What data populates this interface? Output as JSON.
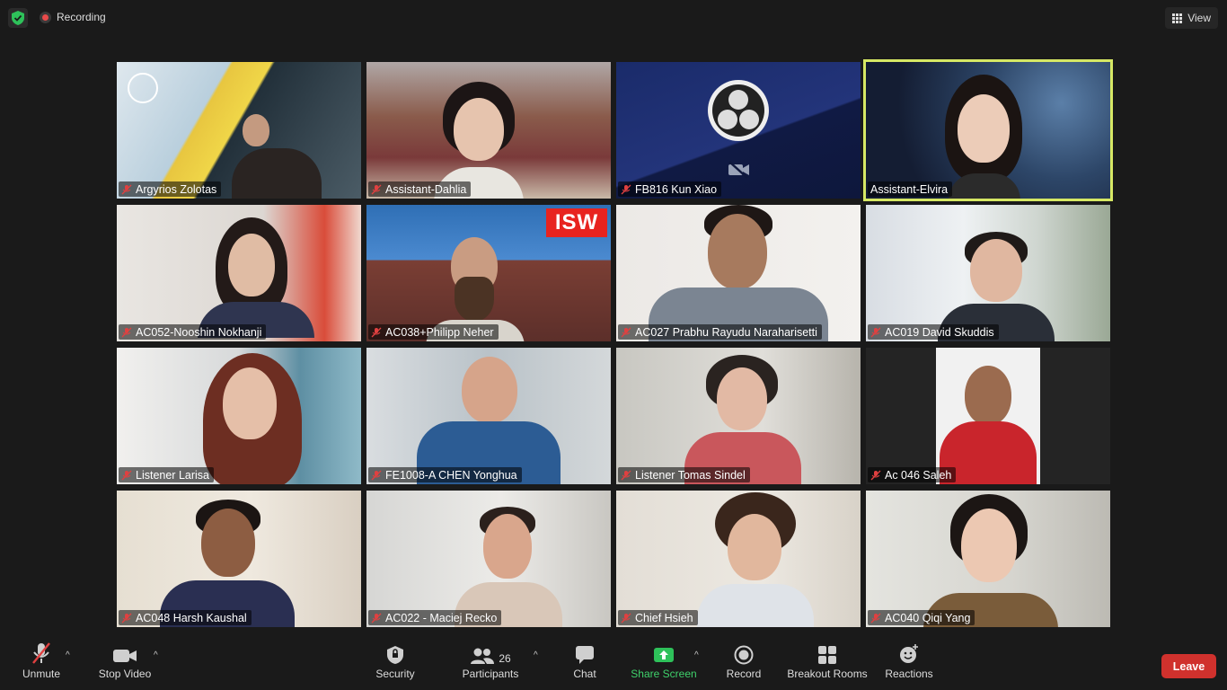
{
  "topbar": {
    "recording": "Recording",
    "view": "View"
  },
  "tiles": [
    {
      "name": "Argyrios Zolotas"
    },
    {
      "name": "Assistant-Dahlia"
    },
    {
      "name": "FB816 Kun Xiao"
    },
    {
      "name": "Assistant-Elvira"
    },
    {
      "name": "AC052-Nooshin Nokhanji"
    },
    {
      "name": "AC038+Philipp Neher"
    },
    {
      "name": "AC027 Prabhu Rayudu Naraharisetti"
    },
    {
      "name": "AC019 David Skuddis"
    },
    {
      "name": "Listener Larisa"
    },
    {
      "name": "FE1008-A CHEN Yonghua"
    },
    {
      "name": "Listener Tomas Sindel"
    },
    {
      "name": "Ac 046 Saleh"
    },
    {
      "name": "AC048 Harsh Kaushal"
    },
    {
      "name": "AC022 - Maciej Recko"
    },
    {
      "name": "Chief Hsieh"
    },
    {
      "name": "AC040 Qiqi Yang"
    }
  ],
  "banner_logo": "ISW",
  "toolbar": {
    "unmute": "Unmute",
    "stop_video": "Stop Video",
    "security": "Security",
    "participants": "Participants",
    "participant_count": "26",
    "chat": "Chat",
    "share_screen": "Share Screen",
    "record": "Record",
    "breakout_rooms": "Breakout Rooms",
    "reactions": "Reactions",
    "leave": "Leave"
  },
  "colors": {
    "accent_green": "#3fd16b",
    "active_speaker": "#d6e864",
    "leave": "#d0312d"
  }
}
